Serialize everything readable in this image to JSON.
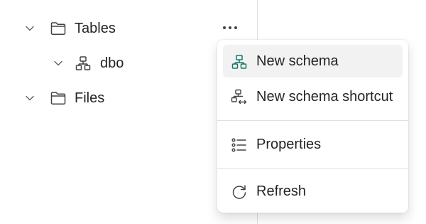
{
  "tree": {
    "items": [
      {
        "label": "Tables",
        "icon": "folder-icon",
        "expanded": true
      },
      {
        "label": "dbo",
        "icon": "schema-icon",
        "expanded": true
      },
      {
        "label": "Files",
        "icon": "folder-icon",
        "expanded": true
      }
    ],
    "more_label": "..."
  },
  "context_menu": {
    "items": [
      {
        "label": "New schema",
        "icon": "schema-icon",
        "hovered": true
      },
      {
        "label": "New schema shortcut",
        "icon": "schema-shortcut-icon"
      },
      {
        "label": "Properties",
        "icon": "properties-list-icon"
      },
      {
        "label": "Refresh",
        "icon": "refresh-icon"
      }
    ]
  },
  "colors": {
    "accent": "#117865",
    "hover_bg": "#f2f2f2",
    "separator": "#e0e0e0",
    "text": "#242424"
  }
}
